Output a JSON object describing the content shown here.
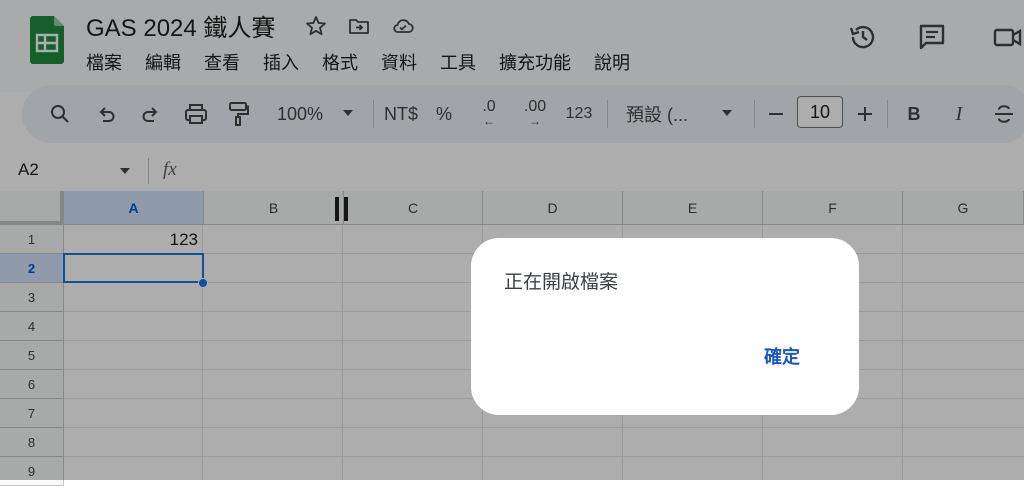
{
  "header": {
    "doc_title": "GAS 2024 鐵人賽",
    "menu": [
      "檔案",
      "編輯",
      "查看",
      "插入",
      "格式",
      "資料",
      "工具",
      "擴充功能",
      "說明"
    ]
  },
  "toolbar": {
    "zoom": "100%",
    "currency": "NT$",
    "percent": "%",
    "dec_decrease": ".0",
    "dec_increase": ".00",
    "number_format": "123",
    "font": "預設 (...",
    "font_size": "10",
    "bold": "B",
    "italic": "I"
  },
  "formula_bar": {
    "cell_ref": "A2",
    "fx": "fx"
  },
  "grid": {
    "columns": [
      "A",
      "B",
      "C",
      "D",
      "E",
      "F",
      "G"
    ],
    "rows": [
      "1",
      "2",
      "3",
      "4",
      "5",
      "6",
      "7",
      "8",
      "9"
    ],
    "cells": {
      "A1": "123"
    },
    "selected_cell": "A2"
  },
  "dialog": {
    "message": "正在開啟檔案",
    "ok_label": "確定"
  },
  "colors": {
    "accent": "#1a56c4",
    "sheets_green": "#1e8e3e",
    "overlay": "rgba(0,0,0,0.32)"
  }
}
